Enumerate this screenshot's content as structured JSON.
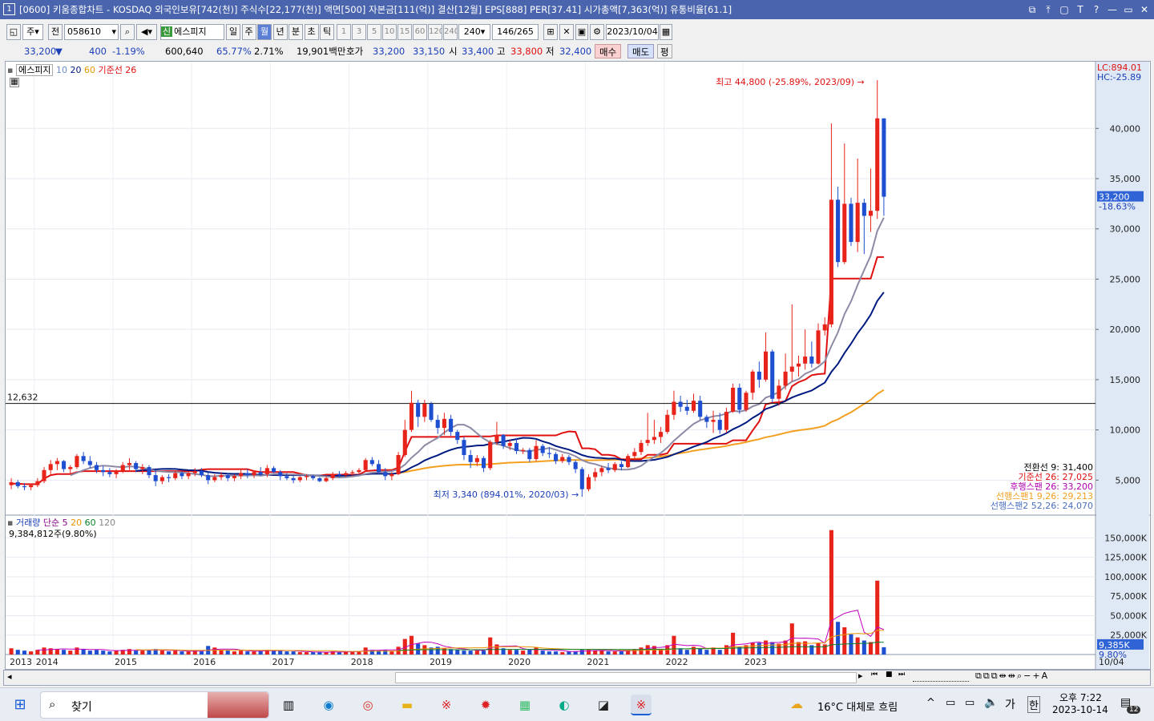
{
  "window": {
    "number": "1",
    "title": "[0600] 키움종합차트 - KOSDAQ 외국인보유[742(천)] 주식수[22,177(천)] 액면[500] 자본금[111(억)] 결산[12월] EPS[888] PER[37.41] 시가총액[7,363(억)] 유통비율[61.1]",
    "controls": [
      "⧉",
      "⤒",
      "▢",
      "T",
      "?",
      "—",
      "▭",
      "✕"
    ]
  },
  "toolbar": {
    "type_label": "주",
    "prev_label": "전",
    "code": "058610",
    "new_badge": "신",
    "stock_name": "에스피지",
    "periods": [
      "일",
      "주",
      "월",
      "년",
      "분",
      "초",
      "틱"
    ],
    "active_period": "월",
    "minute_values": [
      "1",
      "3",
      "5",
      "10",
      "15",
      "60",
      "120",
      "240"
    ],
    "minute_select": "240",
    "count": "146",
    "total": "/265",
    "date": "2023/10/04"
  },
  "quote": {
    "price": "33,200",
    "arrow": "▼",
    "change": "400",
    "change_pct": "-1.19%",
    "volume": "600,640",
    "vol_ratio": "65.77%",
    "turnover": "2.71%",
    "amount": "19,901백만",
    "hoga_label": "호가",
    "ask": "33,200",
    "bid": "33,150",
    "open_label": "시",
    "open": "33,400",
    "high_label": "고",
    "high": "33,800",
    "low_label": "저",
    "low": "32,400",
    "buy_label": "매수",
    "sell_label": "매도",
    "eval_label": "평"
  },
  "price_panel": {
    "legend_name": "에스피지",
    "legend_ma": [
      "10",
      "20",
      "60"
    ],
    "legend_base": "기준선 26",
    "hline_label": "12,632",
    "max_label": "최고 44,800 (-25.89%, 2023/09)",
    "min_label": "최저 3,340 (894.01%, 2020/03)",
    "lc_label": "LC:894.01",
    "hc_label": "HC:-25.89",
    "current_tag": "33,200",
    "current_pct": "-18.63%",
    "y_ticks": [
      "40,000",
      "35,000",
      "30,000",
      "25,000",
      "20,000",
      "15,000",
      "10,000",
      "5,000"
    ],
    "ichimoku": [
      {
        "label": "전환선 9: 31,400",
        "color": "#000000"
      },
      {
        "label": "기준선 26: 27,025",
        "color": "#e01010"
      },
      {
        "label": "후행스팬 26: 33,200",
        "color": "#b000b0"
      },
      {
        "label": "선행스팬1 9,26: 29,213",
        "color": "#f0a020"
      },
      {
        "label": "선행스팬2 52,26: 24,070",
        "color": "#4a6fc0"
      }
    ]
  },
  "volume_panel": {
    "legend_name": "거래량",
    "legend_ma_label": "단순",
    "legend_ma": [
      "5",
      "20",
      "60",
      "120"
    ],
    "vol_text": "9,384,812주(9.80%)",
    "y_ticks": [
      "150,000K",
      "125,000K",
      "100,000K",
      "75,000K",
      "50,000K",
      "25,000K"
    ],
    "current_tag": "9,385K",
    "current_pct": "9.80%"
  },
  "x_axis": {
    "labels": [
      "2013",
      "2014",
      "2015",
      "2016",
      "2017",
      "2018",
      "2019",
      "2020",
      "2021",
      "2022",
      "2023"
    ],
    "end_label": "10/04"
  },
  "taskbar": {
    "search_label": "찾기",
    "weather": "16°C  대체로 흐림",
    "ime": "가",
    "ime2": "한",
    "time": "오후 7:22",
    "date": "2023-10-14",
    "notifications": "12"
  },
  "colors": {
    "title_bar": "#4a65ae",
    "up": "#e8231a",
    "down": "#1f4fd1"
  },
  "chart_data": {
    "type": "candlestick",
    "title": "에스피지",
    "unit": "KRW",
    "period": "monthly",
    "ylim": [
      2000,
      46000
    ],
    "volume_ylim": [
      0,
      170000
    ],
    "x_start": "2013-09",
    "candles": [
      [
        4500,
        5200,
        4100,
        4800,
        8000
      ],
      [
        4800,
        5000,
        4200,
        4400,
        6000
      ],
      [
        4400,
        4700,
        4000,
        4300,
        5000
      ],
      [
        4300,
        4600,
        4000,
        4500,
        4000
      ],
      [
        4500,
        5200,
        4300,
        4900,
        6000
      ],
      [
        4900,
        6300,
        4700,
        6000,
        9000
      ],
      [
        6000,
        7000,
        5600,
        6600,
        8000
      ],
      [
        6600,
        7200,
        6000,
        6900,
        7000
      ],
      [
        6900,
        7000,
        5800,
        6100,
        6000
      ],
      [
        6100,
        6500,
        5600,
        6300,
        5000
      ],
      [
        6300,
        7600,
        6100,
        7400,
        9000
      ],
      [
        7400,
        7800,
        6600,
        6900,
        7000
      ],
      [
        6900,
        7400,
        6200,
        6500,
        5000
      ],
      [
        6500,
        6800,
        5700,
        6000,
        6000
      ],
      [
        6000,
        6400,
        5400,
        5800,
        5000
      ],
      [
        5800,
        6200,
        5300,
        5600,
        4000
      ],
      [
        5600,
        6100,
        5200,
        5900,
        5000
      ],
      [
        5900,
        6800,
        5700,
        6500,
        6000
      ],
      [
        6500,
        7200,
        6000,
        6700,
        7000
      ],
      [
        6700,
        6900,
        5800,
        6100,
        5000
      ],
      [
        6100,
        6600,
        5600,
        6300,
        5000
      ],
      [
        6300,
        6500,
        5200,
        5500,
        6000
      ],
      [
        5500,
        6000,
        4400,
        4900,
        7000
      ],
      [
        4900,
        5500,
        4600,
        5300,
        5000
      ],
      [
        5300,
        5600,
        4800,
        5200,
        4000
      ],
      [
        5200,
        5900,
        5000,
        5700,
        5000
      ],
      [
        5700,
        5900,
        5100,
        5400,
        4000
      ],
      [
        5400,
        5900,
        5100,
        5700,
        4000
      ],
      [
        5700,
        6200,
        5400,
        5900,
        5000
      ],
      [
        5900,
        6200,
        5300,
        5500,
        4000
      ],
      [
        5500,
        5800,
        4600,
        5000,
        11000
      ],
      [
        5000,
        5600,
        4800,
        5300,
        9000
      ],
      [
        5300,
        5800,
        5000,
        5500,
        6000
      ],
      [
        5500,
        5700,
        4900,
        5200,
        5000
      ],
      [
        5200,
        5600,
        4900,
        5400,
        4000
      ],
      [
        5400,
        6000,
        5100,
        5700,
        5000
      ],
      [
        5700,
        6100,
        5200,
        5500,
        4000
      ],
      [
        5500,
        6000,
        5200,
        5800,
        4000
      ],
      [
        5800,
        6300,
        5400,
        5600,
        5000
      ],
      [
        5600,
        6500,
        5300,
        6200,
        6000
      ],
      [
        6200,
        6400,
        5700,
        5800,
        5000
      ],
      [
        5800,
        6000,
        5000,
        5400,
        5000
      ],
      [
        5400,
        5700,
        5000,
        5200,
        4000
      ],
      [
        5200,
        5400,
        4700,
        5000,
        4000
      ],
      [
        5000,
        5400,
        4800,
        5300,
        3000
      ],
      [
        5300,
        5600,
        5000,
        5400,
        3000
      ],
      [
        5400,
        5500,
        5000,
        5200,
        3000
      ],
      [
        5200,
        5300,
        4800,
        4900,
        3000
      ],
      [
        4900,
        5400,
        4800,
        5200,
        3000
      ],
      [
        5200,
        5800,
        5000,
        5600,
        4000
      ],
      [
        5600,
        5900,
        5300,
        5500,
        3000
      ],
      [
        5500,
        5900,
        5300,
        5700,
        4000
      ],
      [
        5700,
        6000,
        5400,
        5800,
        4000
      ],
      [
        5800,
        6200,
        5600,
        6000,
        4000
      ],
      [
        6000,
        7200,
        5900,
        7000,
        9000
      ],
      [
        7000,
        7300,
        6400,
        6600,
        6000
      ],
      [
        6600,
        7000,
        5600,
        5800,
        5000
      ],
      [
        5800,
        6200,
        5000,
        5400,
        6000
      ],
      [
        5400,
        5800,
        5000,
        5600,
        4000
      ],
      [
        5600,
        7800,
        5500,
        7500,
        10000
      ],
      [
        7500,
        11000,
        7300,
        10000,
        20000
      ],
      [
        10000,
        13900,
        9800,
        12700,
        24000
      ],
      [
        12700,
        13000,
        10300,
        11300,
        14000
      ],
      [
        11300,
        13000,
        10800,
        12600,
        12000
      ],
      [
        12600,
        12800,
        10800,
        11000,
        9000
      ],
      [
        11000,
        11500,
        9600,
        10200,
        10000
      ],
      [
        10200,
        11700,
        9500,
        11100,
        8000
      ],
      [
        11100,
        11500,
        9400,
        9800,
        7000
      ],
      [
        9800,
        10000,
        8600,
        9000,
        6000
      ],
      [
        9000,
        9300,
        7000,
        7500,
        5000
      ],
      [
        7500,
        8000,
        6200,
        6800,
        5000
      ],
      [
        6800,
        7500,
        6400,
        7200,
        5000
      ],
      [
        7200,
        7400,
        5800,
        6200,
        5000
      ],
      [
        6200,
        9000,
        6000,
        8800,
        22000
      ],
      [
        8800,
        10800,
        8500,
        9500,
        13000
      ],
      [
        9500,
        9600,
        8100,
        8400,
        8000
      ],
      [
        8400,
        9000,
        8000,
        8700,
        6000
      ],
      [
        8700,
        9200,
        7600,
        7900,
        6000
      ],
      [
        7900,
        8200,
        7600,
        8000,
        5000
      ],
      [
        8000,
        8200,
        6800,
        7100,
        6000
      ],
      [
        7100,
        9000,
        6900,
        8400,
        9000
      ],
      [
        8400,
        8600,
        7400,
        7700,
        5000
      ],
      [
        7700,
        8300,
        7200,
        7600,
        4000
      ],
      [
        7600,
        7800,
        6600,
        6900,
        4000
      ],
      [
        6900,
        7600,
        6700,
        7300,
        3000
      ],
      [
        7300,
        7500,
        6500,
        6800,
        4000
      ],
      [
        6800,
        7000,
        5700,
        6100,
        4000
      ],
      [
        6100,
        6300,
        3340,
        4100,
        6000
      ],
      [
        4100,
        5600,
        3900,
        5300,
        6000
      ],
      [
        5300,
        6200,
        4900,
        5800,
        5000
      ],
      [
        5800,
        6400,
        5400,
        6200,
        5000
      ],
      [
        6200,
        6700,
        5700,
        6000,
        4000
      ],
      [
        6000,
        6800,
        5800,
        6600,
        4000
      ],
      [
        6600,
        6900,
        6000,
        6300,
        4000
      ],
      [
        6300,
        7600,
        6200,
        7400,
        6000
      ],
      [
        7400,
        8200,
        7000,
        7800,
        7000
      ],
      [
        7800,
        9000,
        7500,
        8700,
        9000
      ],
      [
        8700,
        11700,
        8400,
        9000,
        12000
      ],
      [
        9000,
        11000,
        8600,
        9300,
        11000
      ],
      [
        9300,
        10300,
        8700,
        9800,
        7000
      ],
      [
        9800,
        12000,
        9600,
        11500,
        12000
      ],
      [
        11500,
        13900,
        11000,
        12800,
        24000
      ],
      [
        12800,
        13400,
        11800,
        12300,
        8000
      ],
      [
        12300,
        13000,
        11500,
        11900,
        6000
      ],
      [
        11900,
        13600,
        11700,
        12900,
        10000
      ],
      [
        12900,
        13400,
        11000,
        11300,
        8000
      ],
      [
        11300,
        11500,
        10200,
        10800,
        6000
      ],
      [
        10800,
        11900,
        9700,
        11000,
        9000
      ],
      [
        11000,
        11700,
        9600,
        10000,
        6000
      ],
      [
        10000,
        12200,
        9700,
        11800,
        12000
      ],
      [
        11800,
        14600,
        11700,
        14200,
        28000
      ],
      [
        14200,
        14600,
        11600,
        12000,
        10000
      ],
      [
        12000,
        13900,
        11800,
        13700,
        12000
      ],
      [
        13700,
        16000,
        13000,
        15800,
        15000
      ],
      [
        15800,
        16800,
        14200,
        15000,
        15000
      ],
      [
        15000,
        19700,
        14800,
        17800,
        18000
      ],
      [
        17800,
        18000,
        12700,
        13100,
        16000
      ],
      [
        13100,
        15000,
        12400,
        14400,
        14000
      ],
      [
        14400,
        17600,
        14000,
        15800,
        18000
      ],
      [
        15800,
        22500,
        14800,
        16300,
        40000
      ],
      [
        16300,
        17400,
        15300,
        16600,
        16000
      ],
      [
        16600,
        20000,
        16000,
        17300,
        17000
      ],
      [
        17300,
        18800,
        16200,
        16600,
        12000
      ],
      [
        16600,
        20600,
        16500,
        19900,
        15000
      ],
      [
        19900,
        21200,
        19400,
        20500,
        13000
      ],
      [
        20500,
        40500,
        20200,
        32900,
        160000
      ],
      [
        32900,
        34200,
        26200,
        26700,
        42000
      ],
      [
        26700,
        38500,
        26500,
        32500,
        35000
      ],
      [
        32500,
        33100,
        28300,
        28700,
        26000
      ],
      [
        28700,
        37000,
        27700,
        32600,
        22000
      ],
      [
        32600,
        33000,
        27500,
        31300,
        18000
      ],
      [
        31300,
        36000,
        29700,
        31800,
        16000
      ],
      [
        31800,
        44800,
        31000,
        41000,
        95000
      ],
      [
        41000,
        41000,
        31300,
        33200,
        9385
      ]
    ],
    "ma_labels": [
      "10",
      "20",
      "60"
    ],
    "base_line": 26,
    "hline": 12632
  }
}
